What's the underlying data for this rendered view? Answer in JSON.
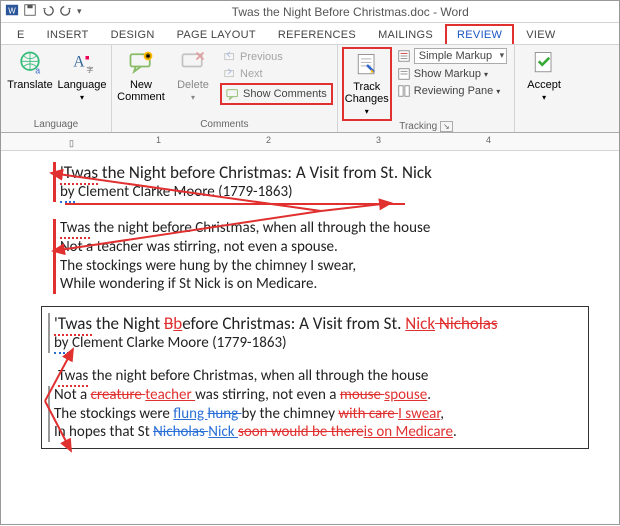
{
  "title": "Twas the Night Before Christmas.doc - Word",
  "tabs": {
    "t0": "E",
    "t1": "INSERT",
    "t2": "DESIGN",
    "t3": "PAGE LAYOUT",
    "t4": "REFERENCES",
    "t5": "MAILINGS",
    "t6": "REVIEW",
    "t7": "VIEW"
  },
  "ribbon": {
    "translate": "Translate",
    "language": "Language",
    "language_grp": "Language",
    "newcomment": "New Comment",
    "delete": "Delete",
    "previous": "Previous",
    "next": "Next",
    "showcomments": "Show Comments",
    "comments_grp": "Comments",
    "trackchanges": "Track Changes",
    "markup": "Simple Markup",
    "showmarkup": "Show Markup",
    "reviewingpane": "Reviewing Pane",
    "tracking_grp": "Tracking",
    "accept": "Accept"
  },
  "ruler": {
    "n1": "1",
    "n2": "2",
    "n3": "3",
    "n4": "4"
  },
  "doc": {
    "s1": {
      "title_a": "'Twas",
      "title_b": " the Night before Christmas: A Visit from St. Nick",
      "by_a": "by",
      "by_b": " Clement Clarke Moore (1779-1863)",
      "l1_a": "Twas",
      "l1_b": " the night before Christmas, when all through the house",
      "l2": "Not a teacher was stirring, not even a spouse.",
      "l3": "The stockings were hung by the chimney I swear,",
      "l4": "While wondering if St Nick is on Medicare."
    },
    "s2": {
      "title_a": "'Twas",
      "title_b": " the Night ",
      "title_c": "B",
      "title_d": "b",
      "title_e": "efore Christmas: A Visit from St. ",
      "title_f": "Nick",
      "title_g": " Nicholas",
      "by_a": "by",
      "by_b": " Clement Clarke Moore (1779-1863)",
      "l1_a": "Twas",
      "l1_b": " the night before Christmas, when all through the house",
      "l2_a": "Not a ",
      "l2_b": "creature ",
      "l2_c": "teacher ",
      "l2_d": "was stirring, not even a ",
      "l2_e": "mouse ",
      "l2_f": "spouse",
      "l2_g": ".",
      "l3_a": "The stockings were ",
      "l3_b": "flung ",
      "l3_c": "hung ",
      "l3_d": "by the chimney ",
      "l3_e": "with care ",
      "l3_f": "I swear",
      "l3_g": ",",
      "l4_a": " In hopes that St ",
      "l4_b": "Nicholas ",
      "l4_c": "Nick ",
      "l4_d": "soon would be there",
      "l4_e": "is on Medicare",
      "l4_f": "."
    }
  }
}
